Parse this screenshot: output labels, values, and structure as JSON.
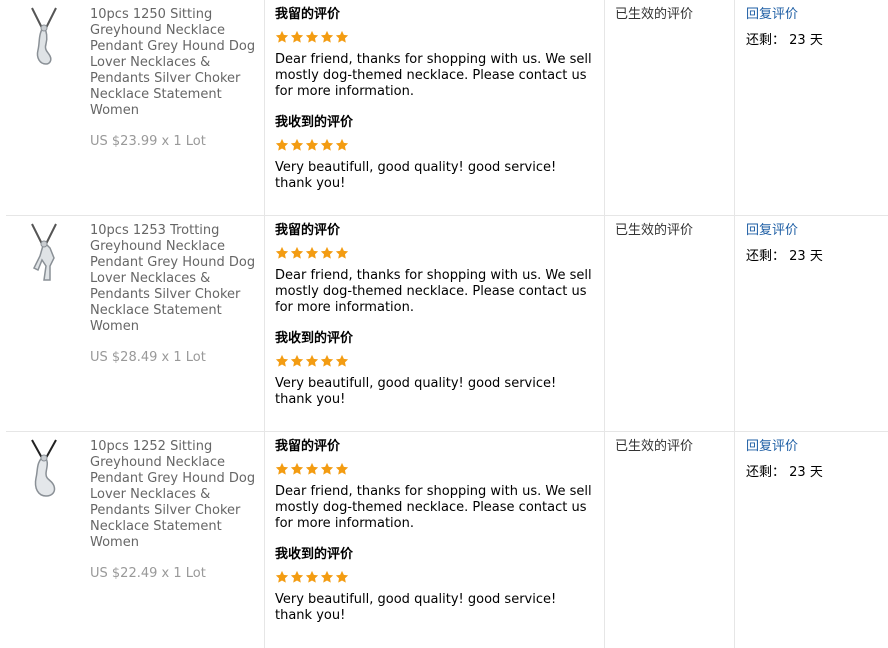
{
  "columns": {
    "status": "已生效的评价",
    "action": "回复评价",
    "remaining_label": "还剩：",
    "remaining_days": "23 天"
  },
  "rows": [
    {
      "product_title": "10pcs 1250 Sitting Greyhound Necklace Pendant Grey Hound Dog Lover Necklaces & Pendants Silver Choker Necklace Statement Women",
      "price": "US $23.99 x 1 Lot",
      "my_feedback_label": "我留的评价",
      "my_rating": 5,
      "my_feedback": "Dear friend, thanks for shopping with us. We sell mostly dog-themed necklace. Please contact us for more information.",
      "received_label": "我收到的评价",
      "received_rating": 5,
      "received_feedback": "Very beautifull, good quality! good service! thank you!"
    },
    {
      "product_title": "10pcs 1253 Trotting Greyhound Necklace Pendant Grey Hound Dog Lover Necklaces & Pendants Silver Choker Necklace Statement Women",
      "price": "US $28.49 x 1 Lot",
      "my_feedback_label": "我留的评价",
      "my_rating": 5,
      "my_feedback": "Dear friend, thanks for shopping with us. We sell mostly dog-themed necklace. Please contact us for more information.",
      "received_label": "我收到的评价",
      "received_rating": 5,
      "received_feedback": "Very beautifull, good quality! good service! thank you!"
    },
    {
      "product_title": "10pcs 1252 Sitting Greyhound Necklace Pendant Grey Hound Dog Lover Necklaces & Pendants Silver Choker Necklace Statement Women",
      "price": "US $22.49 x 1 Lot",
      "my_feedback_label": "我留的评价",
      "my_rating": 5,
      "my_feedback": "Dear friend, thanks for shopping with us. We sell mostly dog-themed necklace. Please contact us for more information.",
      "received_label": "我收到的评价",
      "received_rating": 5,
      "received_feedback": "Very beautifull, good quality! good service! thank you!"
    }
  ],
  "colors": {
    "star": "#f39c12",
    "link": "#1f5fa5",
    "muted": "#999999"
  },
  "icons": {
    "star": "star-icon",
    "product": "necklace-pendant-thumbnail"
  }
}
